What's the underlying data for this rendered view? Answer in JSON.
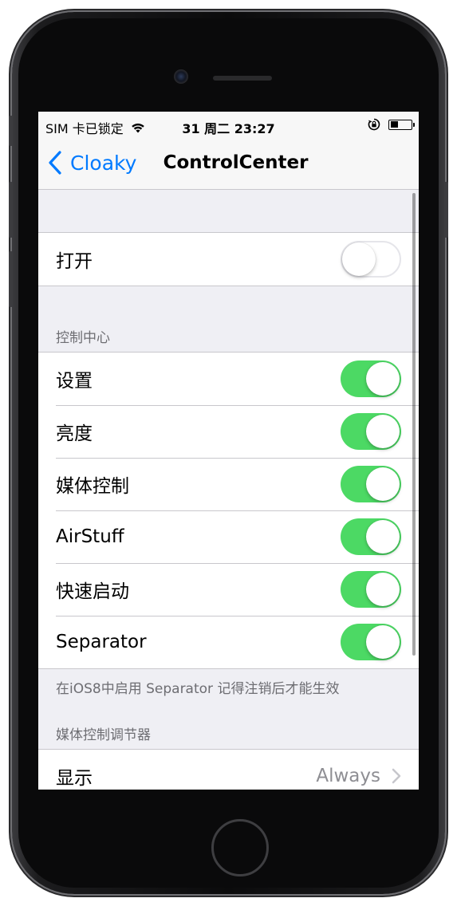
{
  "status_bar": {
    "carrier": "SIM 卡已锁定",
    "time": "31 周二 23:27",
    "battery_level": 0.33
  },
  "nav": {
    "back_label": "Cloaky",
    "title": "ControlCenter"
  },
  "main_toggle": {
    "label": "打开",
    "on": false
  },
  "control_center": {
    "header": "控制中心",
    "items": [
      {
        "label": "设置",
        "on": true
      },
      {
        "label": "亮度",
        "on": true
      },
      {
        "label": "媒体控制",
        "on": true
      },
      {
        "label": "AirStuff",
        "on": true
      },
      {
        "label": "快速启动",
        "on": true
      },
      {
        "label": "Separator",
        "on": true
      }
    ],
    "footer": "在iOS8中启用 Separator 记得注销后才能生效"
  },
  "media_adjuster": {
    "header": "媒体控制调节器",
    "row_label": "显示",
    "row_value": "Always"
  },
  "colors": {
    "accent": "#007aff",
    "toggle_on": "#4cd964",
    "group_bg": "#efeff4"
  }
}
